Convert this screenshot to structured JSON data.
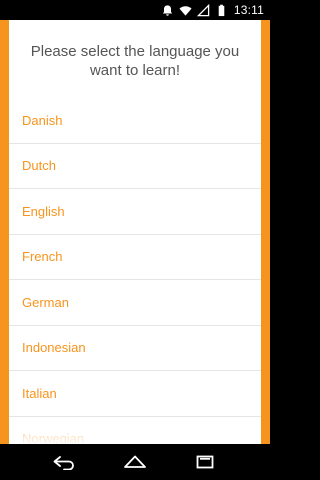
{
  "status_bar": {
    "time": "13:11",
    "icons": [
      "notification-icon",
      "wifi-icon",
      "signal-icon",
      "battery-icon"
    ]
  },
  "main": {
    "prompt": "Please select the language you want to learn!",
    "languages": [
      "Danish",
      "Dutch",
      "English",
      "French",
      "German",
      "Indonesian",
      "Italian",
      "Norwegian"
    ]
  },
  "nav_bar": {
    "buttons": [
      "back-icon",
      "home-icon",
      "recent-apps-icon"
    ]
  },
  "colors": {
    "accent": "#f7941d",
    "background": "#ffffff",
    "prompt_text": "#555555",
    "divider": "#e6e6e6"
  }
}
